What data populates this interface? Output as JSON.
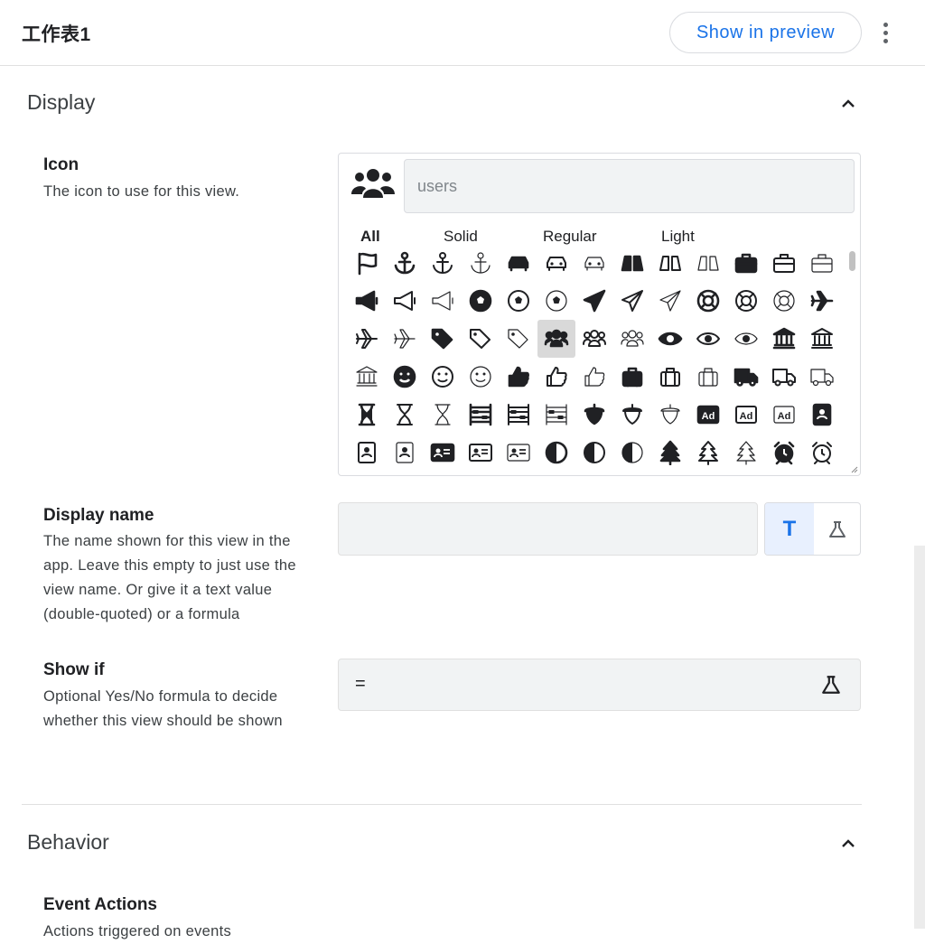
{
  "header": {
    "title": "工作表1",
    "preview_label": "Show in preview"
  },
  "display_section": {
    "title": "Display",
    "icon": {
      "label": "Icon",
      "description": "The icon to use for this view.",
      "selected_icon": "users-icon",
      "search_placeholder": "users",
      "tabs": [
        "All",
        "Solid",
        "Regular",
        "Light"
      ],
      "grid": [
        [
          "flag",
          "anchor",
          "anchor",
          "anchor",
          "car",
          "car",
          "car",
          "binoculars",
          "binoculars",
          "binoculars",
          "briefcase",
          "briefcase",
          "briefcase"
        ],
        [
          "bullhorn",
          "bullhorn",
          "bullhorn",
          "futbol",
          "futbol",
          "futbol",
          "paper-plane",
          "paper-plane",
          "paper-plane",
          "life-ring",
          "life-ring",
          "life-ring",
          "plane"
        ],
        [
          "plane",
          "plane",
          "tags",
          "tags",
          "tags",
          "users",
          "users",
          "users",
          "eye",
          "eye",
          "eye",
          "university",
          "university"
        ],
        [
          "university",
          "smile",
          "smile",
          "smile",
          "thumbs-up",
          "thumbs-up",
          "thumbs-up",
          "suitcase",
          "suitcase",
          "suitcase",
          "truck",
          "truck",
          "truck"
        ],
        [
          "hourglass",
          "hourglass",
          "hourglass",
          "abacus",
          "abacus",
          "abacus",
          "acorn",
          "acorn",
          "acorn",
          "ad",
          "ad",
          "ad",
          "address-book"
        ],
        [
          "address-book",
          "address-book",
          "address-card",
          "address-card",
          "address-card",
          "adjust",
          "adjust",
          "adjust",
          "tree",
          "tree",
          "tree",
          "alarm-clock",
          "alarm-clock"
        ]
      ],
      "selected_cell": "2-5"
    },
    "display_name": {
      "label": "Display name",
      "description": "The name shown for this view in the app. Leave this empty to just use the view name. Or give it a text value (double-quoted) or a formula",
      "value": "",
      "text_toggle": "T"
    },
    "show_if": {
      "label": "Show if",
      "description": "Optional Yes/No formula to decide whether this view should be shown",
      "value": "="
    }
  },
  "behavior_section": {
    "title": "Behavior",
    "event_actions": {
      "label": "Event Actions",
      "description": "Actions triggered on events"
    }
  },
  "colors": {
    "accent": "#1a73e8",
    "field_bg": "#f1f3f4",
    "selected_cell_bg": "#d9d9d9"
  }
}
